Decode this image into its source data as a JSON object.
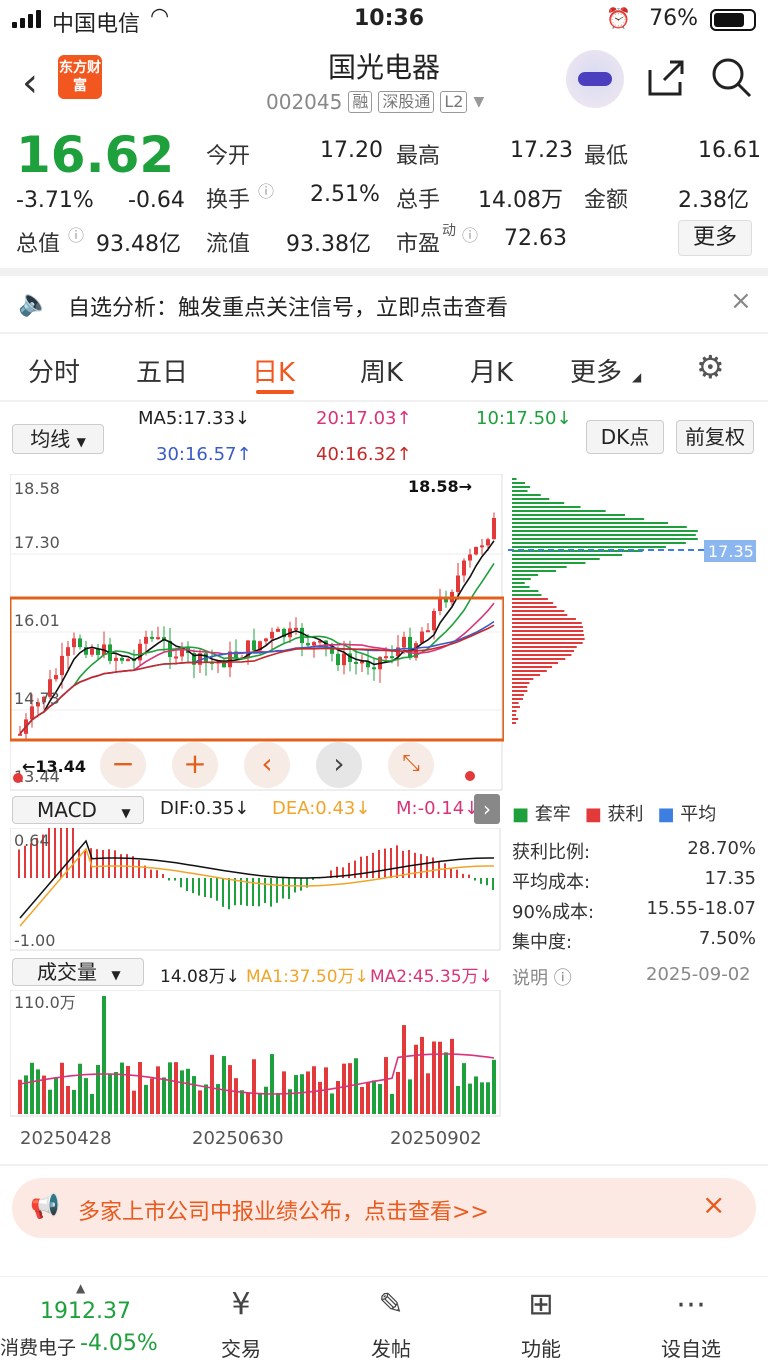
{
  "status_bar": {
    "carrier": "中国电信",
    "time": "10:36",
    "battery": "76%"
  },
  "header": {
    "title": "国光电器",
    "code": "002045",
    "tags": [
      "融",
      "深股通",
      "L2"
    ],
    "logo_text": "东方财富",
    "back_icon": "chevron-left-icon",
    "share_icon": "share-icon",
    "search_icon": "search-icon"
  },
  "quote": {
    "price": "16.62",
    "change_pct": "-3.71%",
    "change": "-0.64",
    "open_label": "今开",
    "open": "17.20",
    "high_label": "最高",
    "high": "17.23",
    "low_label": "最低",
    "low": "16.61",
    "turnover_label": "换手",
    "turnover": "2.51%",
    "volume_label": "总手",
    "volume": "14.08万",
    "amount_label": "金额",
    "amount": "2.38亿",
    "mktcap_label": "总值",
    "mktcap": "93.48亿",
    "float_label": "流值",
    "float": "93.38亿",
    "pe_label": "市盈",
    "pe_sup": "动",
    "pe": "72.63",
    "more_label": "更多"
  },
  "notice": {
    "text": "自选分析：触发重点关注信号，立即点击查看"
  },
  "tabs": [
    {
      "label": "分时"
    },
    {
      "label": "五日"
    },
    {
      "label": "日K"
    },
    {
      "label": "周K"
    },
    {
      "label": "月K"
    },
    {
      "label": "更多"
    }
  ],
  "ma_bar": {
    "select": "均线",
    "ma5": "MA5:17.33↓",
    "ma20": "20:17.03↑",
    "ma10": "10:17.50↓",
    "ma30": "30:16.57↑",
    "ma40": "40:16.32↑",
    "dk_label": "DK点",
    "adj_label": "前复权"
  },
  "kline": {
    "axis": [
      "18.58",
      "17.30",
      "16.01",
      "14.73",
      "13.44"
    ],
    "high_mark": "18.58→",
    "low_mark": "←13.44",
    "chip_price": "17.35"
  },
  "macd": {
    "select": "MACD",
    "dif": "DIF:0.35↓",
    "dea": "DEA:0.43↓",
    "m": "M:-0.14↓",
    "top": "0.64",
    "bottom": "-1.00"
  },
  "chip_panel": {
    "legend": [
      "套牢",
      "获利",
      "平均"
    ],
    "rows": [
      {
        "label": "获利比例:",
        "value": "28.70%"
      },
      {
        "label": "平均成本:",
        "value": "17.35"
      },
      {
        "label": "90%成本:",
        "value": "15.55-18.07"
      },
      {
        "label": "集中度:",
        "value": "7.50%"
      }
    ],
    "note_label": "说明",
    "date": "2025-09-02"
  },
  "volume": {
    "select": "成交量",
    "vol": "14.08万↓",
    "ma1": "MA1:37.50万↓",
    "ma2": "MA2:45.35万↓",
    "top": "110.0万",
    "dates": [
      "20250428",
      "20250630",
      "20250902"
    ]
  },
  "banner": {
    "text": "多家上市公司中报业绩公布，点击查看>>"
  },
  "bottom": {
    "index_value": "1912.37",
    "index_name": "消费电子",
    "index_change": "-4.05%",
    "items": [
      "交易",
      "发帖",
      "功能",
      "设自选"
    ]
  },
  "colors": {
    "up": "#e23a3a",
    "down": "#1ea03c",
    "accent": "#f2571f"
  }
}
